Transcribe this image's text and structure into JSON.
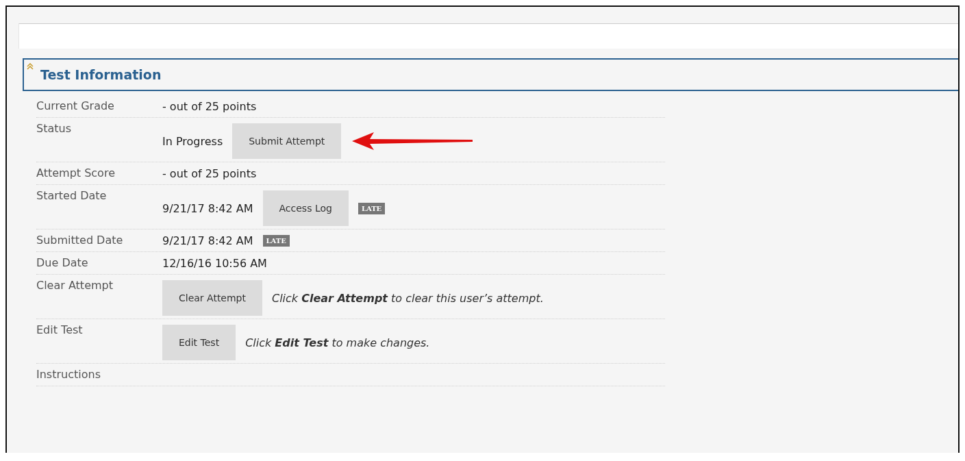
{
  "section": {
    "title": "Test Information",
    "expanded": true
  },
  "rows": [
    {
      "label": "Current Grade",
      "items": [
        {
          "kind": "text",
          "text": "- out of 25 points"
        }
      ]
    },
    {
      "label": "Status",
      "items": [
        {
          "kind": "text",
          "text": "In Progress"
        },
        {
          "kind": "button",
          "text": "Submit Attempt"
        },
        {
          "kind": "arrow"
        }
      ]
    },
    {
      "label": "Attempt Score",
      "items": [
        {
          "kind": "text",
          "text": "- out of 25 points"
        }
      ]
    },
    {
      "label": "Started Date",
      "items": [
        {
          "kind": "text",
          "text": "9/21/17 8:42 AM"
        },
        {
          "kind": "button",
          "text": "Access Log"
        },
        {
          "kind": "badge",
          "text": "LATE"
        }
      ]
    },
    {
      "label": "Submitted Date",
      "items": [
        {
          "kind": "text",
          "text": "9/21/17 8:42 AM"
        },
        {
          "kind": "badge",
          "text": "LATE"
        }
      ]
    },
    {
      "label": "Due Date",
      "items": [
        {
          "kind": "text",
          "text": "12/16/16 10:56 AM"
        }
      ]
    },
    {
      "label": "Clear Attempt",
      "items": [
        {
          "kind": "button",
          "text": "Clear Attempt"
        },
        {
          "kind": "note",
          "text": "Click **Clear Attempt** to clear this user’s attempt."
        }
      ]
    },
    {
      "label": "Edit Test",
      "items": [
        {
          "kind": "button",
          "text": "Edit Test"
        },
        {
          "kind": "note",
          "text": "Click **Edit Test** to make changes."
        }
      ]
    },
    {
      "label": "Instructions",
      "items": []
    }
  ]
}
